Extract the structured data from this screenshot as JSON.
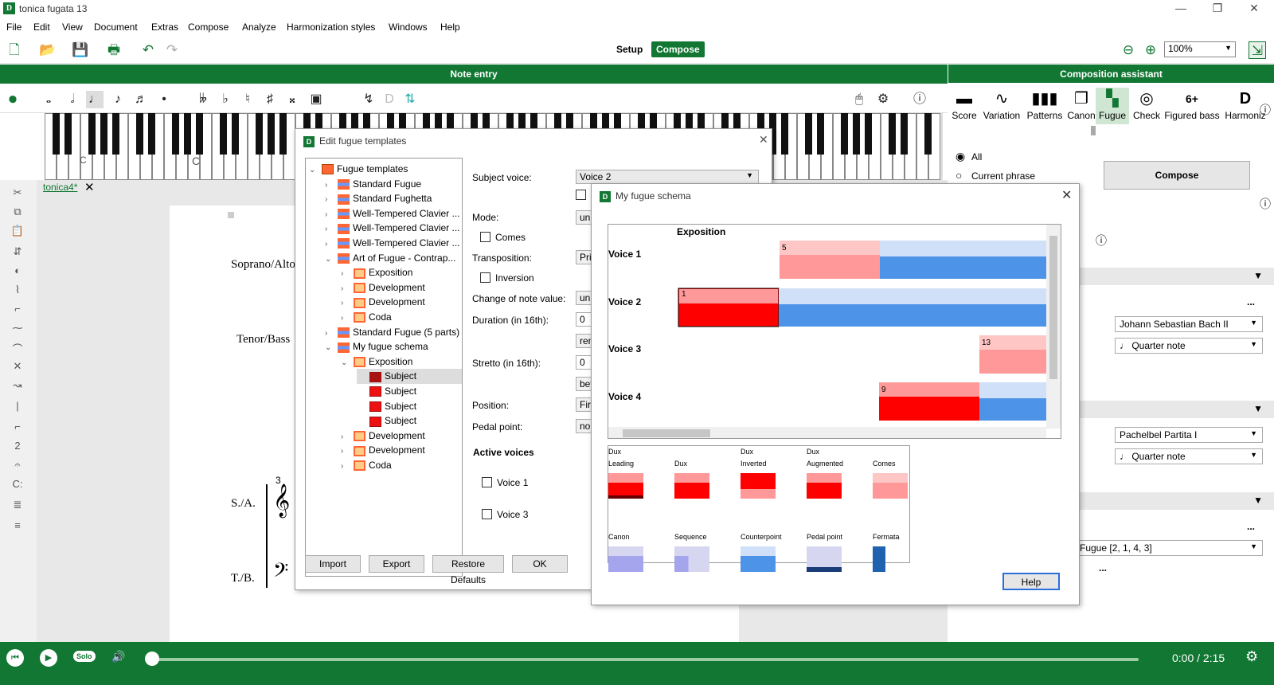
{
  "app": {
    "title": "tonica fugata 13",
    "logo": "D"
  },
  "menu": [
    "File",
    "Edit",
    "View",
    "Document",
    "Extras",
    "Compose",
    "Analyze",
    "Harmonization styles",
    "Windows",
    "Help"
  ],
  "toolbar": {
    "setup_label": "Setup",
    "compose_label": "Compose",
    "zoom": "100%"
  },
  "bars": {
    "note_entry": "Note entry",
    "assistant": "Composition assistant"
  },
  "score": {
    "tab_label": "tonica4*",
    "staff_labels": [
      "Soprano/Alto",
      "Tenor/Bass",
      "S./A.",
      "T./B."
    ],
    "measure_number": "3",
    "key_letters": [
      "C",
      "C"
    ]
  },
  "fugue_templates_dialog": {
    "title": "Edit fugue templates",
    "tree": [
      {
        "label": "Fugue templates",
        "level": 0,
        "expanded": true
      },
      {
        "label": "Standard Fugue",
        "level": 1
      },
      {
        "label": "Standard Fughetta",
        "level": 1
      },
      {
        "label": "Well-Tempered Clavier ...",
        "level": 1
      },
      {
        "label": "Well-Tempered Clavier ...",
        "level": 1
      },
      {
        "label": "Well-Tempered Clavier ...",
        "level": 1
      },
      {
        "label": "Art of Fugue - Contrap...",
        "level": 1,
        "expanded": true
      },
      {
        "label": "Exposition",
        "level": 2
      },
      {
        "label": "Development",
        "level": 2
      },
      {
        "label": "Development",
        "level": 2
      },
      {
        "label": "Coda",
        "level": 2
      },
      {
        "label": "Standard Fugue (5 parts)",
        "level": 1
      },
      {
        "label": "My fugue schema",
        "level": 1,
        "expanded": true
      },
      {
        "label": "Exposition",
        "level": 2,
        "expanded": true
      },
      {
        "label": "Subject",
        "level": 3,
        "selected": true
      },
      {
        "label": "Subject",
        "level": 3
      },
      {
        "label": "Subject",
        "level": 3
      },
      {
        "label": "Subject",
        "level": 3
      },
      {
        "label": "Development",
        "level": 2
      },
      {
        "label": "Development",
        "level": 2
      },
      {
        "label": "Coda",
        "level": 2
      }
    ],
    "labels": {
      "subject_voice": "Subject voice:",
      "mode": "Mode:",
      "comes": "Comes",
      "transposition": "Transposition:",
      "inversion": "Inversion",
      "change_note_value": "Change of note value:",
      "duration": "Duration (in 16th):",
      "stretto": "Stretto (in 16th):",
      "position": "Position:",
      "pedal_point": "Pedal point:",
      "active_voices": "Active voices",
      "voice1": "Voice 1",
      "voice3": "Voice 3"
    },
    "values": {
      "subject_voice": "Voice 2",
      "mode": "un",
      "transposition": "Pri",
      "change_note_value": "un",
      "duration": "0",
      "ren": "ren",
      "stretto": "0",
      "bef": "bef",
      "position": "Firs",
      "pedal_point": "no"
    },
    "buttons": {
      "import": "Import",
      "export": "Export",
      "restore": "Restore Defaults",
      "ok": "OK"
    }
  },
  "schema_dialog": {
    "title": "My fugue schema",
    "section": "Exposition",
    "voices": [
      {
        "label": "Voice 1",
        "entry_number": "5"
      },
      {
        "label": "Voice 2",
        "entry_number": "1"
      },
      {
        "label": "Voice 3",
        "entry_number": "13"
      },
      {
        "label": "Voice 4",
        "entry_number": "9"
      }
    ],
    "legend": [
      {
        "label": "Dux\nLeading"
      },
      {
        "label": "Dux"
      },
      {
        "label": "Dux\nInverted"
      },
      {
        "label": "Dux\nAugmented"
      },
      {
        "label": "Comes"
      },
      {
        "label": "Canon"
      },
      {
        "label": "Sequence"
      },
      {
        "label": "Counterpoint"
      },
      {
        "label": "Pedal point"
      },
      {
        "label": "Fermata"
      }
    ],
    "help_button": "Help"
  },
  "assistant": {
    "tabs": [
      "Score",
      "Variation",
      "Patterns",
      "Canon",
      "Fugue",
      "Check",
      "Figured bass",
      "Harmoniz"
    ],
    "active_tab": "Fugue",
    "figured_bass_glyph": "6+",
    "harmoniz_glyph": "D",
    "radio_all": "All",
    "radio_phrase": "Current phrase",
    "compose_button": "Compose",
    "dropdowns": {
      "composer1": "Johann Sebastian Bach II",
      "note1": "Quarter note",
      "composer2": "Pachelbel Partita I",
      "note2": "Quarter note",
      "fugue": "Fugue [2, 1, 4, 3]"
    },
    "ellipsis": "..."
  },
  "player": {
    "time": "0:00 / 2:15",
    "solo": "Solo"
  },
  "colors": {
    "brand": "#117733",
    "subject_red": "#ff0000",
    "subject_pink": "#ff9999",
    "cp_blue": "#4d94e8"
  }
}
